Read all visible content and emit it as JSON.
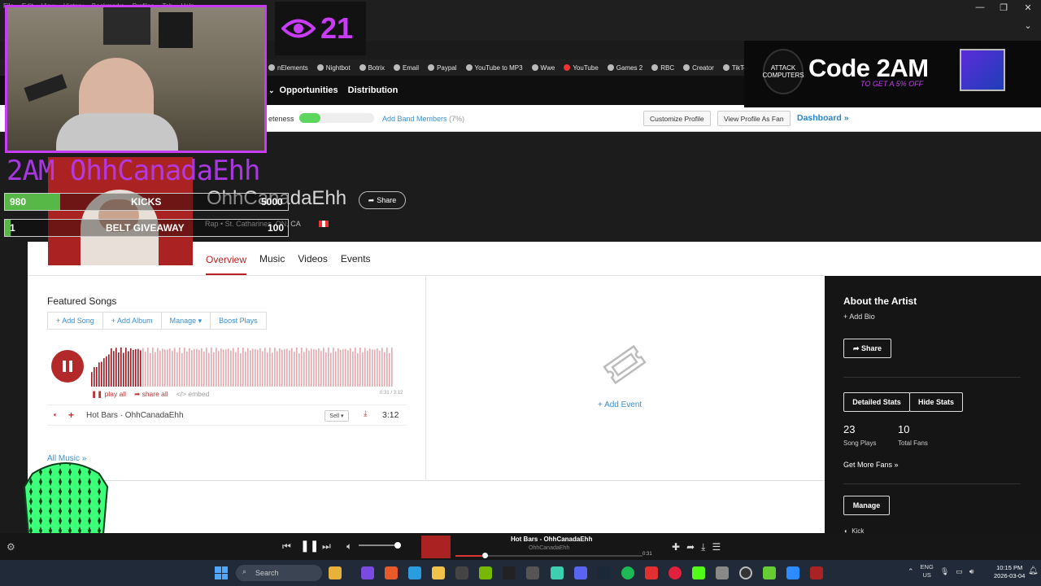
{
  "browser": {
    "menu": [
      "File",
      "Edit",
      "View",
      "History",
      "Bookmarks",
      "Profiles",
      "Tab",
      "Help"
    ],
    "bookmarks": [
      "nElements",
      "Nightbot",
      "Botrix",
      "Email",
      "Paypal",
      "YouTube to MP3",
      "Wwe",
      "YouTube",
      "Games 2",
      "RBC",
      "Creator",
      "TikTok"
    ]
  },
  "site_nav": {
    "items": [
      "Opportunities",
      "Distribution"
    ]
  },
  "profile_bar": {
    "label": "eteness",
    "completeness": 0.28,
    "add_members": "Add Band Members",
    "add_members_pct": "(7%)",
    "customize": "Customize Profile",
    "view_as_fan": "View Profile As Fan",
    "dashboard": "Dashboard »"
  },
  "artist": {
    "name": "OhhCanadaEhh",
    "share": "Share",
    "location": "Rap  •  St. Catharines, ON, CA"
  },
  "tabs": [
    "Overview",
    "Music",
    "Videos",
    "Events"
  ],
  "songs": {
    "title": "Featured Songs",
    "actions": [
      "+ Add Song",
      "+ Add Album",
      "Manage ▾",
      "Boost Plays"
    ],
    "play_all": "play all",
    "share_all": "share all",
    "embed": "embed",
    "time": "0:31 / 3:12",
    "track": {
      "title": "Hot Bars · OhhCanadaEhh",
      "sell": "Sell ▾",
      "duration": "3:12"
    },
    "all_music": "All Music »",
    "played_fraction": 0.17
  },
  "events": {
    "add_event": "+ Add Event"
  },
  "sidebar": {
    "about_title": "About the Artist",
    "add_bio": "+ Add Bio",
    "share": "Share",
    "detailed_stats": "Detailed Stats",
    "hide_stats": "Hide Stats",
    "song_plays": "23",
    "song_plays_label": "Song Plays",
    "total_fans": "10",
    "total_fans_label": "Total Fans",
    "more_fans": "Get More Fans »",
    "manage": "Manage",
    "kick": "Kick"
  },
  "overlay": {
    "viewers": "21",
    "promo_title": "Code 2AM",
    "promo_sub": "TO GET A 5% OFF",
    "promo_logo": "ATTACK COMPUTERS",
    "stream_name": "2AM OhhCanadaEhh",
    "goals": [
      {
        "current": "980",
        "label": "KICKS",
        "target": "5000",
        "fraction": 0.196
      },
      {
        "current": "1",
        "label": "BELT GIVEAWAY",
        "target": "100",
        "fraction": 0.01
      }
    ]
  },
  "media": {
    "title": "Hot Bars - OhhCanadaEhh",
    "artist": "OhhCanadaEhh",
    "elapsed": "0:31",
    "volume": 0.92
  },
  "taskbar": {
    "search": "Search",
    "lang": "ENG",
    "region": "US",
    "time": "10:15 PM",
    "date": "2026-03-04"
  },
  "colors": {
    "accent_red": "#b22222",
    "link_blue": "#3a8fd0",
    "stream_purple": "#c83cf5",
    "progress_green": "#5cd65c"
  }
}
